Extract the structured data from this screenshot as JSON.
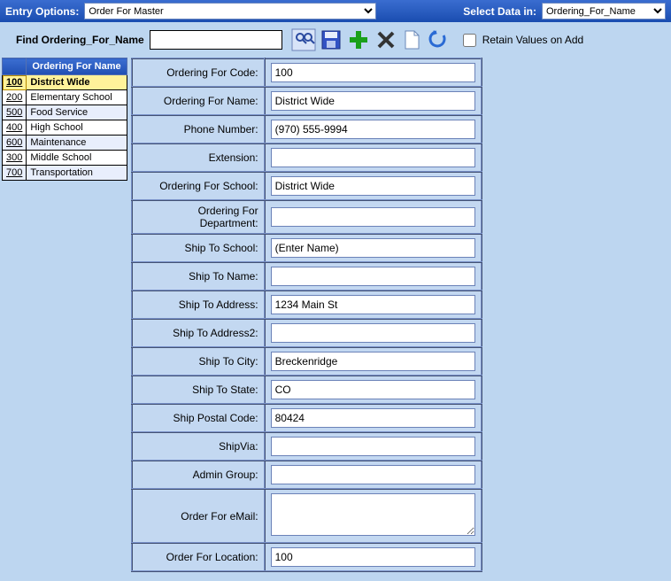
{
  "topbar": {
    "entry_options_label": "Entry Options:",
    "entry_options_value": "Order For Master",
    "select_data_label": "Select Data in:",
    "select_data_value": "Ordering_For_Name"
  },
  "toolbar": {
    "find_label": "Find Ordering_For_Name",
    "find_value": "",
    "retain_label": "Retain Values on Add",
    "retain_checked": false
  },
  "grid": {
    "header_code": "",
    "header_name": "Ordering For Name",
    "rows": [
      {
        "code": "100",
        "name": "District Wide",
        "selected": true
      },
      {
        "code": "200",
        "name": "Elementary School",
        "selected": false
      },
      {
        "code": "500",
        "name": "Food Service",
        "selected": false
      },
      {
        "code": "400",
        "name": "High School",
        "selected": false
      },
      {
        "code": "600",
        "name": "Maintenance",
        "selected": false
      },
      {
        "code": "300",
        "name": "Middle School",
        "selected": false
      },
      {
        "code": "700",
        "name": "Transportation",
        "selected": false
      }
    ]
  },
  "form": {
    "fields": [
      {
        "label": "Ordering For Code:",
        "value": "100",
        "type": "text"
      },
      {
        "label": "Ordering For Name:",
        "value": "District Wide",
        "type": "text"
      },
      {
        "label": "Phone Number:",
        "value": "(970) 555-9994",
        "type": "text"
      },
      {
        "label": "Extension:",
        "value": "",
        "type": "text"
      },
      {
        "label": "Ordering For School:",
        "value": "District Wide",
        "type": "text"
      },
      {
        "label": "Ordering For Department:",
        "value": "",
        "type": "text"
      },
      {
        "label": "Ship To School:",
        "value": "(Enter Name)",
        "type": "text"
      },
      {
        "label": "Ship To Name:",
        "value": "",
        "type": "text"
      },
      {
        "label": "Ship To Address:",
        "value": "1234 Main St",
        "type": "text"
      },
      {
        "label": "Ship To Address2:",
        "value": "",
        "type": "text"
      },
      {
        "label": "Ship To City:",
        "value": "Breckenridge",
        "type": "text"
      },
      {
        "label": "Ship To State:",
        "value": "CO",
        "type": "text"
      },
      {
        "label": "Ship Postal Code:",
        "value": "80424",
        "type": "text"
      },
      {
        "label": "ShipVia:",
        "value": "",
        "type": "text"
      },
      {
        "label": "Admin Group:",
        "value": "",
        "type": "text"
      },
      {
        "label": "Order For eMail:",
        "value": "",
        "type": "textarea"
      },
      {
        "label": "Order For Location:",
        "value": "100",
        "type": "text"
      }
    ]
  }
}
